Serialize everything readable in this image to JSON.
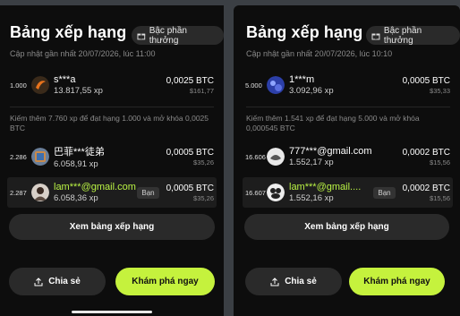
{
  "left": {
    "title": "Bảng xếp hạng",
    "reward_label": "Bậc phần thưởng",
    "updated": "Cập nhật gần nhất 20/07/2026, lúc 11:00",
    "top": {
      "rank": "1.000",
      "name": "s***a",
      "xp": "13.817,55 xp",
      "btc": "0,0025 BTC",
      "usd": "$161,77"
    },
    "hint": "Kiếm thêm 7.760 xp để đạt hạng 1.000 và mở khóa 0,0025 BTC",
    "rows": [
      {
        "rank": "2.286",
        "name": "巴菲***徒弟",
        "xp": "6.058,91 xp",
        "btc": "0,0005 BTC",
        "usd": "$35,26",
        "me": false,
        "badge": ""
      },
      {
        "rank": "2.287",
        "name": "lam***@gmail.com",
        "xp": "6.058,36 xp",
        "btc": "0,0005 BTC",
        "usd": "$35,26",
        "me": true,
        "badge": "Bạn"
      }
    ],
    "view_label": "Xem bảng xếp hạng",
    "share_label": "Chia sẻ",
    "explore_label": "Khám phá ngay"
  },
  "right": {
    "title": "Bảng xếp hạng",
    "reward_label": "Bậc phần thưởng",
    "updated": "Cập nhật gần nhất 20/07/2026, lúc 10:10",
    "top": {
      "rank": "5.000",
      "name": "1***m",
      "xp": "3.092,96 xp",
      "btc": "0,0005 BTC",
      "usd": "$35,33"
    },
    "hint": "Kiếm thêm 1.541 xp để đạt hạng 5.000 và mở khóa 0,000545 BTC",
    "rows": [
      {
        "rank": "16.606",
        "name": "777***@gmail.com",
        "xp": "1.552,17 xp",
        "btc": "0,0002 BTC",
        "usd": "$15,56",
        "me": false,
        "badge": ""
      },
      {
        "rank": "16.607",
        "name": "lam***@gmail....",
        "xp": "1.552,16 xp",
        "btc": "0,0002 BTC",
        "usd": "$15,56",
        "me": true,
        "badge": "Bạn"
      }
    ],
    "view_label": "Xem bảng xếp hạng",
    "share_label": "Chia sẻ",
    "explore_label": "Khám phá ngay"
  },
  "colors": {
    "accent": "#c5f23d",
    "background": "#0d0d0d",
    "me_name": "#b9f244"
  },
  "icons": {
    "reward": "gift-icon",
    "share": "share-icon"
  }
}
